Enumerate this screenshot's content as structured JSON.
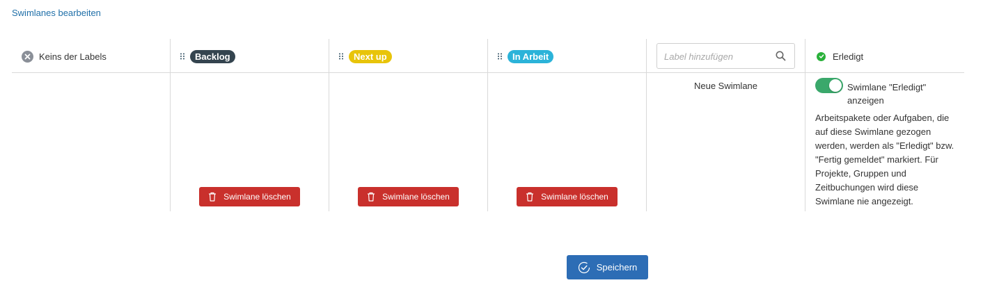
{
  "header": {
    "link_label": "Swimlanes bearbeiten"
  },
  "columns": {
    "none": {
      "label": "Keins der Labels",
      "icon": "x-circle-icon"
    },
    "backlog": {
      "label": "Backlog",
      "color": "#34444f",
      "delete_label": "Swimlane löschen"
    },
    "next_up": {
      "label": "Next up",
      "color": "#e8c40a",
      "delete_label": "Swimlane löschen"
    },
    "in_arbeit": {
      "label": "In Arbeit",
      "color": "#2bb3d9",
      "delete_label": "Swimlane löschen"
    },
    "add": {
      "placeholder": "Label hinzufügen",
      "new_label": "Neue Swimlane"
    },
    "done": {
      "label": "Erledigt",
      "toggle_on": true,
      "toggle_label": "Swimlane \"Erledigt\" anzeigen",
      "description": "Arbeitspakete oder Aufgaben, die auf diese Swimlane gezogen werden, werden als \"Erledigt\" bzw. \"Fertig gemeldet\" markiert. Für Projekte, Gruppen und Zeitbuchungen wird diese Swimlane nie angezeigt."
    }
  },
  "footer": {
    "save_label": "Speichern"
  },
  "colors": {
    "link": "#1f6fa8",
    "delete": "#c9302c",
    "save": "#2d6db5",
    "toggle": "#3aa86b",
    "done_check": "#29b13a"
  }
}
